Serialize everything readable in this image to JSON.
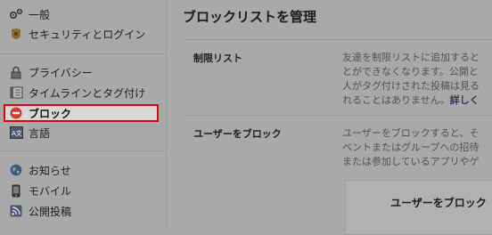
{
  "sidebar": {
    "items": [
      {
        "label": "一般",
        "icon": "gears-icon"
      },
      {
        "label": "セキュリティとログイン",
        "icon": "security-badge-icon"
      },
      {
        "label": "プライバシー",
        "icon": "lock-icon"
      },
      {
        "label": "タイムラインとタグ付け",
        "icon": "timeline-icon"
      },
      {
        "label": "ブロック",
        "icon": "block-icon",
        "active": true
      },
      {
        "label": "言語",
        "icon": "language-icon"
      },
      {
        "label": "お知らせ",
        "icon": "globe-icon"
      },
      {
        "label": "モバイル",
        "icon": "mobile-icon"
      },
      {
        "label": "公開投稿",
        "icon": "rss-icon"
      }
    ]
  },
  "main": {
    "title": "ブロックリストを管理",
    "sections": [
      {
        "label": "制限リスト",
        "lines": [
          "友達を制限リストに追加すると",
          "とができなくなります。公開と",
          "人がタグ付けされた投稿は見る",
          "れることはありません。"
        ],
        "link": "詳しく"
      },
      {
        "label": "ユーザーをブロック",
        "lines": [
          "ユーザーをブロックすると、そ",
          "ベントまたはグループへの招待",
          "または参加しているアプリやゲ"
        ]
      }
    ],
    "block_box_title": "ユーザーをブロック"
  },
  "colors": {
    "accent": "#e1000f",
    "link": "#2c3a56"
  }
}
